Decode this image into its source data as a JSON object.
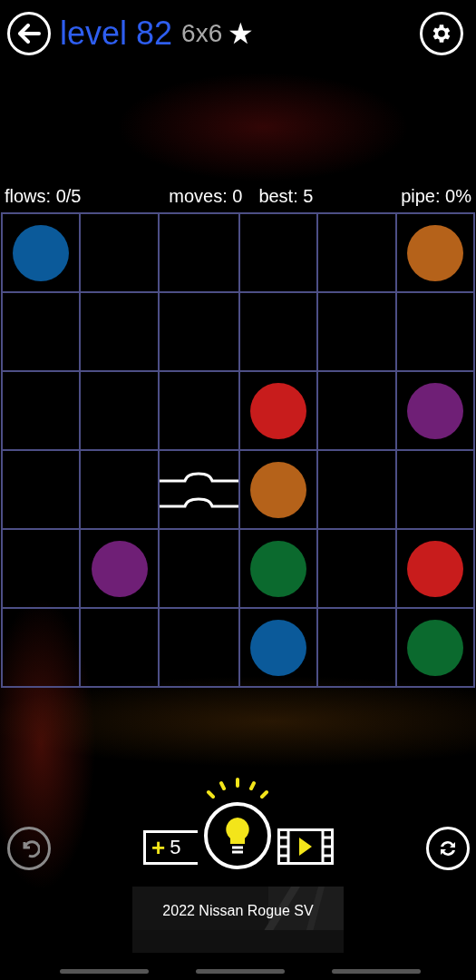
{
  "header": {
    "level": "level 82",
    "size": "6x6",
    "star": "★"
  },
  "stats": {
    "flows": "flows: 0/5",
    "moves": "moves: 0",
    "best": "best: 5",
    "pipe": "pipe: 0%"
  },
  "grid": {
    "rows": [
      [
        {
          "kind": "dot",
          "color": "#0b5a9a"
        },
        {
          "kind": "empty"
        },
        {
          "kind": "empty"
        },
        {
          "kind": "empty"
        },
        {
          "kind": "empty"
        },
        {
          "kind": "dot",
          "color": "#b5621a"
        }
      ],
      [
        {
          "kind": "empty"
        },
        {
          "kind": "empty"
        },
        {
          "kind": "empty"
        },
        {
          "kind": "empty"
        },
        {
          "kind": "empty"
        },
        {
          "kind": "empty"
        }
      ],
      [
        {
          "kind": "empty"
        },
        {
          "kind": "empty"
        },
        {
          "kind": "empty"
        },
        {
          "kind": "dot",
          "color": "#c81c1c"
        },
        {
          "kind": "empty"
        },
        {
          "kind": "dot",
          "color": "#6f1f76"
        }
      ],
      [
        {
          "kind": "empty"
        },
        {
          "kind": "empty"
        },
        {
          "kind": "bridge"
        },
        {
          "kind": "dot",
          "color": "#b5621a"
        },
        {
          "kind": "empty"
        },
        {
          "kind": "empty"
        }
      ],
      [
        {
          "kind": "empty"
        },
        {
          "kind": "dot",
          "color": "#6f1f76"
        },
        {
          "kind": "empty"
        },
        {
          "kind": "dot",
          "color": "#0b6a2e"
        },
        {
          "kind": "empty"
        },
        {
          "kind": "dot",
          "color": "#c81c1c"
        }
      ],
      [
        {
          "kind": "empty"
        },
        {
          "kind": "empty"
        },
        {
          "kind": "empty"
        },
        {
          "kind": "dot",
          "color": "#0b5a9a"
        },
        {
          "kind": "empty"
        },
        {
          "kind": "dot",
          "color": "#0b6a2e"
        }
      ]
    ]
  },
  "hints": {
    "plus": "+",
    "count": "5"
  },
  "ad": {
    "text": "2022 Nissan Rogue SV"
  }
}
